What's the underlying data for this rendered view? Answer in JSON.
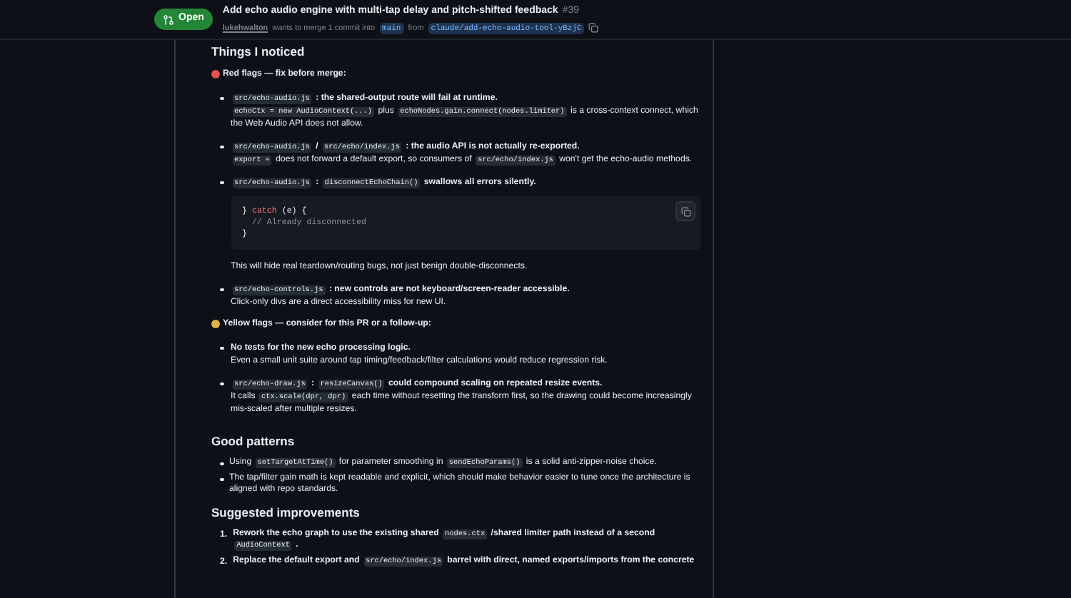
{
  "header": {
    "badge": "Open",
    "title": "Add echo audio engine with multi-tap delay and pitch-shifted feedback",
    "number": "#39",
    "author": "lukehwalton",
    "merge_text": "wants to merge 1 commit into",
    "base_branch": "main",
    "from_text": "from",
    "head_branch": "claude/add-echo-audio-tool-yBzjC"
  },
  "sections": [
    {
      "heading": "Things I noticed",
      "groups": [
        {
          "label": "Red flags — fix before merge:",
          "color": "#e5534b",
          "items": [
            {
              "title": [
                {
                  "kind": "code",
                  "text": "src/echo-audio.js"
                },
                {
                  "kind": "text",
                  "text": " : the shared-output route will fail at runtime."
                }
              ],
              "body": [
                {
                  "kind": "code",
                  "text": "echoCtx = new AudioContext(...)"
                },
                {
                  "kind": "text",
                  "text": " plus "
                },
                {
                  "kind": "code",
                  "text": "echoNodes.gain.connect(nodes.limiter)"
                },
                {
                  "kind": "text",
                  "text": " is a cross-context connect, which the Web Audio API does not allow."
                }
              ]
            },
            {
              "title": [
                {
                  "kind": "code",
                  "text": "src/echo-audio.js"
                },
                {
                  "kind": "text",
                  "text": " / "
                },
                {
                  "kind": "code",
                  "text": "src/echo/index.js"
                },
                {
                  "kind": "text",
                  "text": " : the audio API is not actually re-exported."
                }
              ],
              "body": [
                {
                  "kind": "code",
                  "text": "export ="
                },
                {
                  "kind": "text",
                  "text": " does not forward a default export, so consumers of "
                },
                {
                  "kind": "code",
                  "text": "src/echo/index.js"
                },
                {
                  "kind": "text",
                  "text": " won't get the echo-audio methods."
                }
              ]
            },
            {
              "title": [
                {
                  "kind": "code",
                  "text": "src/echo-audio.js"
                },
                {
                  "kind": "text",
                  "text": " : "
                },
                {
                  "kind": "code",
                  "text": "disconnectEchoChain()"
                },
                {
                  "kind": "text",
                  "text": " swallows all errors silently."
                }
              ],
              "code_block": [
                [
                  {
                    "kind": "punct",
                    "text": "} "
                  },
                  {
                    "kind": "keyword",
                    "text": "catch"
                  },
                  {
                    "kind": "punct",
                    "text": " (e) {"
                  }
                ],
                [
                  {
                    "kind": "comment",
                    "text": "  // Already disconnected"
                  }
                ],
                [
                  {
                    "kind": "punct",
                    "text": "}"
                  }
                ]
              ],
              "after": [
                {
                  "kind": "text",
                  "text": "This will hide real teardown/routing bugs, not just benign double-disconnects."
                }
              ]
            },
            {
              "title": [
                {
                  "kind": "code",
                  "text": "src/echo-controls.js"
                },
                {
                  "kind": "text",
                  "text": " : new controls are not keyboard/screen-reader accessible."
                }
              ],
              "body": [
                {
                  "kind": "text",
                  "text": "Click-only divs are a direct accessibility miss for new UI."
                }
              ]
            }
          ]
        },
        {
          "label": "Yellow flags — consider for this PR or a follow-up:",
          "color": "#e3b341",
          "items": [
            {
              "title": [
                {
                  "kind": "text",
                  "text": "No tests for the new echo processing logic."
                }
              ],
              "body": [
                {
                  "kind": "text",
                  "text": "Even a small unit suite around tap timing/feedback/filter calculations would reduce regression risk."
                }
              ]
            },
            {
              "title": [
                {
                  "kind": "code",
                  "text": "src/echo-draw.js"
                },
                {
                  "kind": "text",
                  "text": " : "
                },
                {
                  "kind": "code",
                  "text": "resizeCanvas()"
                },
                {
                  "kind": "text",
                  "text": " could compound scaling on repeated resize events."
                }
              ],
              "body": [
                {
                  "kind": "text",
                  "text": "It calls "
                },
                {
                  "kind": "code",
                  "text": "ctx.scale(dpr, dpr)"
                },
                {
                  "kind": "text",
                  "text": " each time without resetting the transform first, so the drawing could become increasingly mis-scaled after multiple resizes."
                }
              ]
            }
          ]
        }
      ]
    },
    {
      "heading": "Good patterns",
      "items": [
        {
          "kind": "bullet",
          "text": [
            {
              "kind": "text",
              "text": "Using "
            },
            {
              "kind": "code",
              "text": "setTargetAtTime()"
            },
            {
              "kind": "text",
              "text": " for parameter smoothing in "
            },
            {
              "kind": "code",
              "text": "sendEchoParams()"
            },
            {
              "kind": "text",
              "text": " is a solid anti-zipper-noise choice."
            }
          ]
        },
        {
          "kind": "bullet",
          "text": [
            {
              "kind": "text",
              "text": "The tap/filter gain math is kept readable and explicit, which should make behavior easier to tune once the architecture is aligned with repo standards."
            }
          ]
        }
      ]
    },
    {
      "heading": "Suggested improvements",
      "items": [
        {
          "kind": "ordered",
          "number": "1.",
          "text": [
            {
              "kind": "text",
              "text": "Rework the echo graph to use the existing shared "
            },
            {
              "kind": "code",
              "text": "nodes.ctx"
            },
            {
              "kind": "text",
              "text": " /shared limiter path instead of a second "
            },
            {
              "kind": "code",
              "text": "AudioContext"
            },
            {
              "kind": "text",
              "text": " ."
            }
          ]
        },
        {
          "kind": "ordered",
          "number": "2.",
          "text": [
            {
              "kind": "text",
              "text": "Replace the default export and "
            },
            {
              "kind": "code",
              "text": "src/echo/index.js"
            },
            {
              "kind": "text",
              "text": " barrel with direct, named exports/imports from the concrete"
            }
          ]
        }
      ]
    }
  ]
}
